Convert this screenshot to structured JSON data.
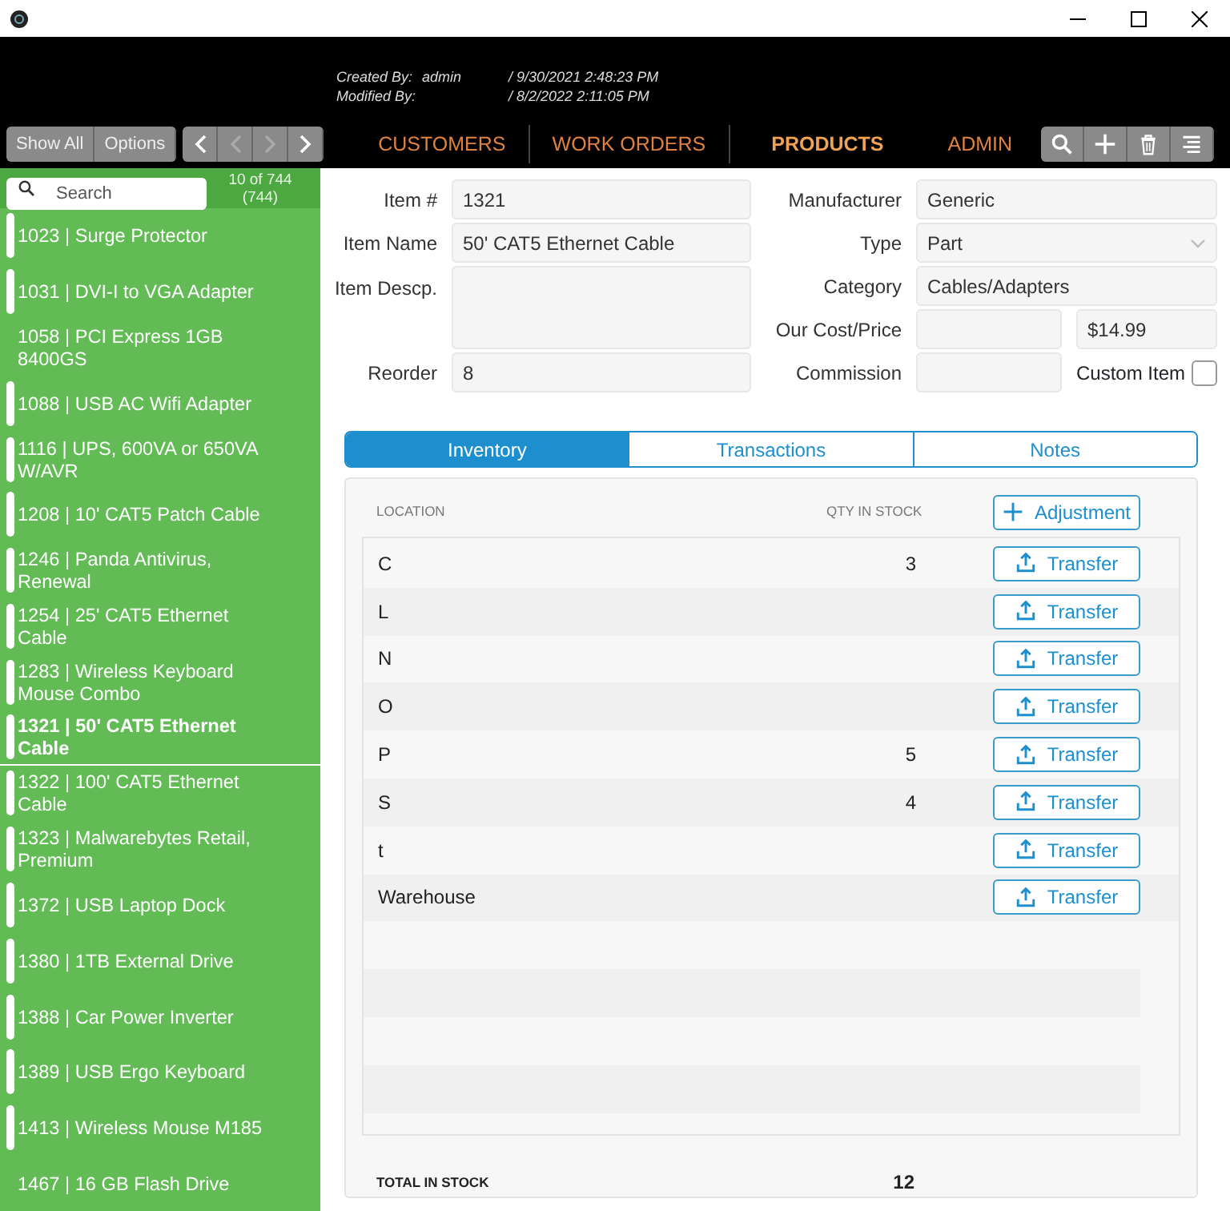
{
  "header": {
    "created_label": "Created By:",
    "created_by": "admin",
    "created_at": "/ 9/30/2021 2:48:23 PM",
    "modified_label": "Modified By:",
    "modified_at": "/ 8/2/2022 2:11:05 PM"
  },
  "toolbar": {
    "buttons": [
      "Show All",
      "Options"
    ],
    "nav_buttons": [
      {
        "kind": "prev",
        "disabled": false
      },
      {
        "kind": "prev",
        "disabled": true
      },
      {
        "kind": "next",
        "disabled": true
      },
      {
        "kind": "next",
        "disabled": false
      }
    ],
    "tabs": [
      {
        "label": "CUSTOMERS",
        "selected": false
      },
      {
        "label": "WORK ORDERS",
        "selected": false
      },
      {
        "label": "PRODUCTS",
        "selected": true
      },
      {
        "label": "ADMIN",
        "selected": false
      }
    ],
    "actions": [
      {
        "kind": "search"
      },
      {
        "kind": "add"
      },
      {
        "kind": "delete"
      },
      {
        "kind": "menu"
      }
    ]
  },
  "sidebar": {
    "search": {
      "placeholder": "Search"
    },
    "count": "10 of 744",
    "total": "(744)",
    "items": [
      {
        "label": "1023 | Surge Protector",
        "marked": true,
        "selected": false
      },
      {
        "label": "1031 | DVI-I to VGA Adapter",
        "marked": true,
        "selected": false
      },
      {
        "label": "1058 | PCI Express 1GB 8400GS",
        "marked": false,
        "selected": false
      },
      {
        "label": "1088 | USB AC Wifi Adapter",
        "marked": true,
        "selected": false
      },
      {
        "label": "1116 | UPS, 600VA or 650VA W/AVR",
        "marked": true,
        "selected": false
      },
      {
        "label": "1208 | 10' CAT5 Patch Cable",
        "marked": true,
        "selected": false
      },
      {
        "label": "1246 | Panda Antivirus, Renewal",
        "marked": true,
        "selected": false
      },
      {
        "label": "1254 | 25' CAT5 Ethernet Cable",
        "marked": true,
        "selected": false
      },
      {
        "label": "1283 | Wireless Keyboard Mouse Combo",
        "marked": true,
        "selected": false
      },
      {
        "label": "1321 | 50' CAT5 Ethernet Cable",
        "marked": true,
        "selected": true
      },
      {
        "label": "1322 | 100' CAT5 Ethernet Cable",
        "marked": true,
        "selected": false
      },
      {
        "label": "1323 | Malwarebytes Retail, Premium",
        "marked": true,
        "selected": false
      },
      {
        "label": "1372 | USB Laptop Dock",
        "marked": true,
        "selected": false
      },
      {
        "label": "1380 | 1TB External Drive",
        "marked": true,
        "selected": false
      },
      {
        "label": "1388 | Car Power Inverter",
        "marked": true,
        "selected": false
      },
      {
        "label": "1389 | USB Ergo Keyboard",
        "marked": true,
        "selected": false
      },
      {
        "label": "1413 | Wireless Mouse M185",
        "marked": true,
        "selected": false
      },
      {
        "label": "1467 | 16 GB Flash Drive",
        "marked": false,
        "selected": false
      }
    ]
  },
  "form": {
    "item_no": {
      "label": "Item #",
      "value": "1321"
    },
    "item_name": {
      "label": "Item Name",
      "value": "50' CAT5 Ethernet Cable"
    },
    "description": {
      "label": "Item Descp."
    },
    "reorder": {
      "label": "Reorder",
      "value": "8"
    },
    "manufacturer": {
      "label": "Manufacturer",
      "value": "Generic"
    },
    "type": {
      "label": "Type",
      "value": "Part"
    },
    "category": {
      "label": "Category",
      "value": "Cables/Adapters"
    },
    "cost_price": {
      "label": "Our Cost/Price",
      "price": "$14.99"
    },
    "commission": {
      "label": "Commission"
    },
    "custom_item": {
      "label": "Custom Item",
      "checked": false
    }
  },
  "detail_tabs": [
    {
      "label": "Inventory",
      "selected": true
    },
    {
      "label": "Transactions",
      "selected": false
    },
    {
      "label": "Notes",
      "selected": false
    }
  ],
  "inventory": {
    "columns": [
      "LOCATION",
      "QTY IN STOCK"
    ],
    "adjust_button": "Adjustment",
    "rows": [
      {
        "location": "C",
        "qty": "3",
        "button": "Transfer"
      },
      {
        "location": "L",
        "button": "Transfer"
      },
      {
        "location": "N",
        "button": "Transfer"
      },
      {
        "location": "O",
        "button": "Transfer"
      },
      {
        "location": "P",
        "qty": "5",
        "button": "Transfer"
      },
      {
        "location": "S",
        "qty": "4",
        "button": "Transfer"
      },
      {
        "location": "t",
        "button": "Transfer"
      },
      {
        "location": "Warehouse",
        "button": "Transfer"
      }
    ],
    "total_label": "TOTAL IN STOCK",
    "total": "12"
  }
}
